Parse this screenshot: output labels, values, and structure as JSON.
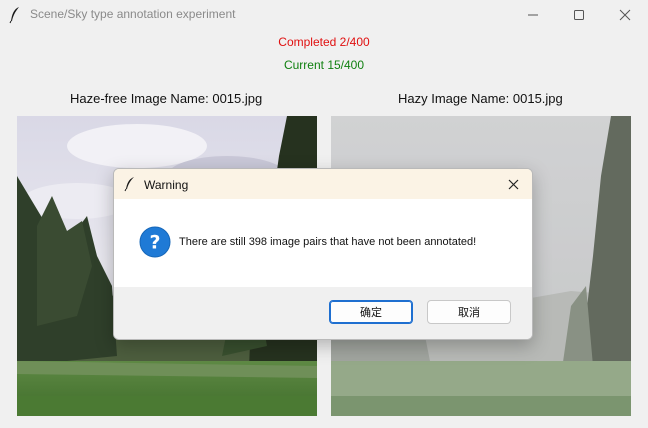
{
  "window": {
    "title": "Scene/Sky type annotation experiment",
    "app_icon": "feather-icon"
  },
  "status": {
    "completed": "Completed 2/400",
    "current": "Current 15/400",
    "completed_color": "#e01010",
    "current_color": "#108010"
  },
  "images": {
    "left_label": "Haze-free Image Name: 0015.jpg",
    "right_label": "Hazy Image Name: 0015.jpg"
  },
  "dialog": {
    "title": "Warning",
    "icon": "question-icon",
    "message": "There are still 398 image pairs that have not been annotated!",
    "ok_label": "确定",
    "cancel_label": "取消",
    "accent_color": "#1e6fd0"
  }
}
